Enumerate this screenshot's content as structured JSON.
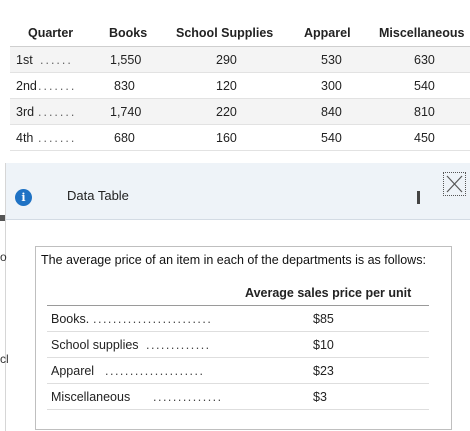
{
  "quarter_table": {
    "headers": {
      "quarter": "Quarter",
      "books": "Books",
      "school_supplies": "School Supplies",
      "apparel": "Apparel",
      "miscellaneous": "Miscellaneous"
    },
    "rows": [
      {
        "quarter": "1st",
        "leader": "......",
        "books": "1,550",
        "school_supplies": "290",
        "apparel": "530",
        "miscellaneous": "630"
      },
      {
        "quarter": "2nd",
        "leader": ".......",
        "books": "830",
        "school_supplies": "120",
        "apparel": "300",
        "miscellaneous": "540"
      },
      {
        "quarter": "3rd",
        "leader": ".......",
        "books": "1,740",
        "school_supplies": "220",
        "apparel": "840",
        "miscellaneous": "810"
      },
      {
        "quarter": "4th",
        "leader": ".......",
        "books": "680",
        "school_supplies": "160",
        "apparel": "540",
        "miscellaneous": "450"
      }
    ]
  },
  "dialog": {
    "title": "Data Table",
    "info_icon": "i",
    "intro_text": "The average price of an item in each of the departments is as follows:",
    "price_header": "Average sales price per unit",
    "price_rows": [
      {
        "department": "Books.",
        "leader": "........................",
        "price": "$85"
      },
      {
        "department": "School supplies",
        "leader": ".............",
        "price": "$10"
      },
      {
        "department": "Apparel",
        "leader": "....................",
        "price": "$23"
      },
      {
        "department": "Miscellaneous",
        "leader": "..............",
        "price": "$3"
      }
    ],
    "background_fragments": [
      "o",
      "cl"
    ],
    "colors": {
      "header_bg": "#eef3f8",
      "info_icon": "#1f72c4"
    }
  }
}
